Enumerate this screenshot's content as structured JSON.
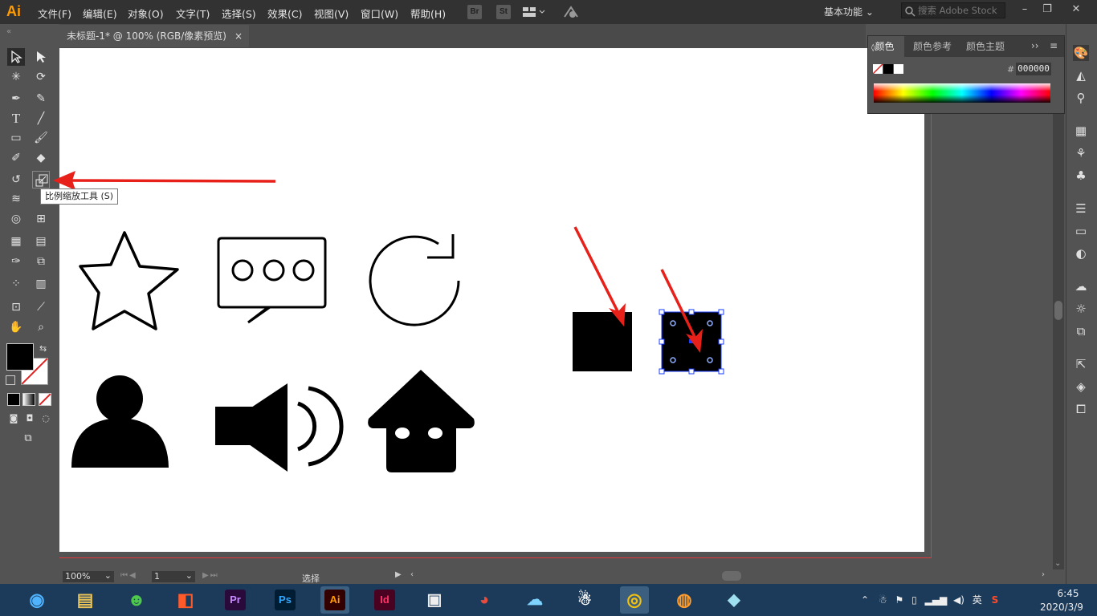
{
  "app": {
    "logo": "Ai"
  },
  "menu": [
    "文件(F)",
    "编辑(E)",
    "对象(O)",
    "文字(T)",
    "选择(S)",
    "效果(C)",
    "视图(V)",
    "窗口(W)",
    "帮助(H)"
  ],
  "menubar_icons": {
    "bridge": "Br",
    "stock": "St"
  },
  "workspace": "基本功能",
  "search": {
    "placeholder": "搜索 Adobe Stock"
  },
  "document": {
    "tab_title": "未标题-1* @ 100% (RGB/像素预览)",
    "close": "×"
  },
  "tooltip": "比例缩放工具 (S)",
  "color_panel": {
    "tabs": [
      "颜色",
      "颜色参考",
      "颜色主题"
    ],
    "hex_label": "#",
    "hex_value": "000000"
  },
  "status": {
    "zoom": "100%",
    "page": "1",
    "tool": "选择"
  },
  "taskbar": {
    "apps": [
      "Pr",
      "Ps",
      "Ai",
      "Id"
    ],
    "tray_lang": "英",
    "time": "6:45",
    "date": "2020/3/9"
  },
  "colors": {
    "accent_orange": "#ff9a00",
    "arrow_red": "#e8201a",
    "selection_blue": "#1a3cff",
    "fill": "#000000"
  },
  "icons": [
    "selection-icon",
    "direct-selection-icon",
    "magic-wand-icon",
    "lasso-icon",
    "pen-icon",
    "curvature-icon",
    "type-icon",
    "line-icon",
    "rectangle-icon",
    "paintbrush-icon",
    "shaper-icon",
    "eraser-icon",
    "rotate-icon",
    "scale-icon"
  ]
}
